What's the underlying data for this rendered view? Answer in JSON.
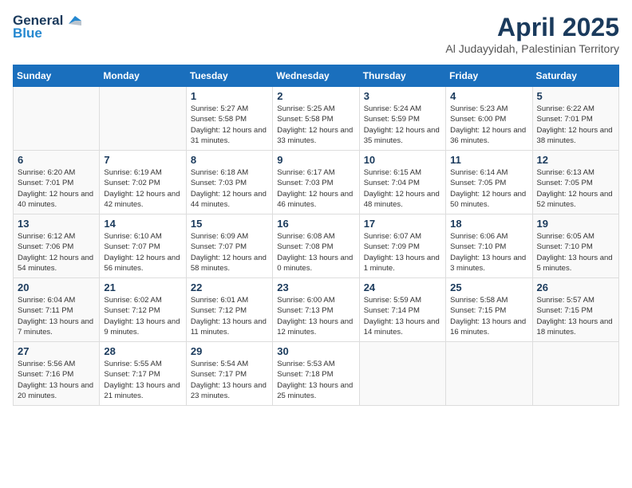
{
  "header": {
    "logo_general": "General",
    "logo_blue": "Blue",
    "month_title": "April 2025",
    "subtitle": "Al Judayyidah, Palestinian Territory"
  },
  "weekdays": [
    "Sunday",
    "Monday",
    "Tuesday",
    "Wednesday",
    "Thursday",
    "Friday",
    "Saturday"
  ],
  "weeks": [
    [
      {
        "day": "",
        "info": ""
      },
      {
        "day": "",
        "info": ""
      },
      {
        "day": "1",
        "info": "Sunrise: 5:27 AM\nSunset: 5:58 PM\nDaylight: 12 hours\nand 31 minutes."
      },
      {
        "day": "2",
        "info": "Sunrise: 5:25 AM\nSunset: 5:58 PM\nDaylight: 12 hours\nand 33 minutes."
      },
      {
        "day": "3",
        "info": "Sunrise: 5:24 AM\nSunset: 5:59 PM\nDaylight: 12 hours\nand 35 minutes."
      },
      {
        "day": "4",
        "info": "Sunrise: 5:23 AM\nSunset: 6:00 PM\nDaylight: 12 hours\nand 36 minutes."
      },
      {
        "day": "5",
        "info": "Sunrise: 6:22 AM\nSunset: 7:01 PM\nDaylight: 12 hours\nand 38 minutes."
      }
    ],
    [
      {
        "day": "6",
        "info": "Sunrise: 6:20 AM\nSunset: 7:01 PM\nDaylight: 12 hours\nand 40 minutes."
      },
      {
        "day": "7",
        "info": "Sunrise: 6:19 AM\nSunset: 7:02 PM\nDaylight: 12 hours\nand 42 minutes."
      },
      {
        "day": "8",
        "info": "Sunrise: 6:18 AM\nSunset: 7:03 PM\nDaylight: 12 hours\nand 44 minutes."
      },
      {
        "day": "9",
        "info": "Sunrise: 6:17 AM\nSunset: 7:03 PM\nDaylight: 12 hours\nand 46 minutes."
      },
      {
        "day": "10",
        "info": "Sunrise: 6:15 AM\nSunset: 7:04 PM\nDaylight: 12 hours\nand 48 minutes."
      },
      {
        "day": "11",
        "info": "Sunrise: 6:14 AM\nSunset: 7:05 PM\nDaylight: 12 hours\nand 50 minutes."
      },
      {
        "day": "12",
        "info": "Sunrise: 6:13 AM\nSunset: 7:05 PM\nDaylight: 12 hours\nand 52 minutes."
      }
    ],
    [
      {
        "day": "13",
        "info": "Sunrise: 6:12 AM\nSunset: 7:06 PM\nDaylight: 12 hours\nand 54 minutes."
      },
      {
        "day": "14",
        "info": "Sunrise: 6:10 AM\nSunset: 7:07 PM\nDaylight: 12 hours\nand 56 minutes."
      },
      {
        "day": "15",
        "info": "Sunrise: 6:09 AM\nSunset: 7:07 PM\nDaylight: 12 hours\nand 58 minutes."
      },
      {
        "day": "16",
        "info": "Sunrise: 6:08 AM\nSunset: 7:08 PM\nDaylight: 13 hours\nand 0 minutes."
      },
      {
        "day": "17",
        "info": "Sunrise: 6:07 AM\nSunset: 7:09 PM\nDaylight: 13 hours\nand 1 minute."
      },
      {
        "day": "18",
        "info": "Sunrise: 6:06 AM\nSunset: 7:10 PM\nDaylight: 13 hours\nand 3 minutes."
      },
      {
        "day": "19",
        "info": "Sunrise: 6:05 AM\nSunset: 7:10 PM\nDaylight: 13 hours\nand 5 minutes."
      }
    ],
    [
      {
        "day": "20",
        "info": "Sunrise: 6:04 AM\nSunset: 7:11 PM\nDaylight: 13 hours\nand 7 minutes."
      },
      {
        "day": "21",
        "info": "Sunrise: 6:02 AM\nSunset: 7:12 PM\nDaylight: 13 hours\nand 9 minutes."
      },
      {
        "day": "22",
        "info": "Sunrise: 6:01 AM\nSunset: 7:12 PM\nDaylight: 13 hours\nand 11 minutes."
      },
      {
        "day": "23",
        "info": "Sunrise: 6:00 AM\nSunset: 7:13 PM\nDaylight: 13 hours\nand 12 minutes."
      },
      {
        "day": "24",
        "info": "Sunrise: 5:59 AM\nSunset: 7:14 PM\nDaylight: 13 hours\nand 14 minutes."
      },
      {
        "day": "25",
        "info": "Sunrise: 5:58 AM\nSunset: 7:15 PM\nDaylight: 13 hours\nand 16 minutes."
      },
      {
        "day": "26",
        "info": "Sunrise: 5:57 AM\nSunset: 7:15 PM\nDaylight: 13 hours\nand 18 minutes."
      }
    ],
    [
      {
        "day": "27",
        "info": "Sunrise: 5:56 AM\nSunset: 7:16 PM\nDaylight: 13 hours\nand 20 minutes."
      },
      {
        "day": "28",
        "info": "Sunrise: 5:55 AM\nSunset: 7:17 PM\nDaylight: 13 hours\nand 21 minutes."
      },
      {
        "day": "29",
        "info": "Sunrise: 5:54 AM\nSunset: 7:17 PM\nDaylight: 13 hours\nand 23 minutes."
      },
      {
        "day": "30",
        "info": "Sunrise: 5:53 AM\nSunset: 7:18 PM\nDaylight: 13 hours\nand 25 minutes."
      },
      {
        "day": "",
        "info": ""
      },
      {
        "day": "",
        "info": ""
      },
      {
        "day": "",
        "info": ""
      }
    ]
  ]
}
